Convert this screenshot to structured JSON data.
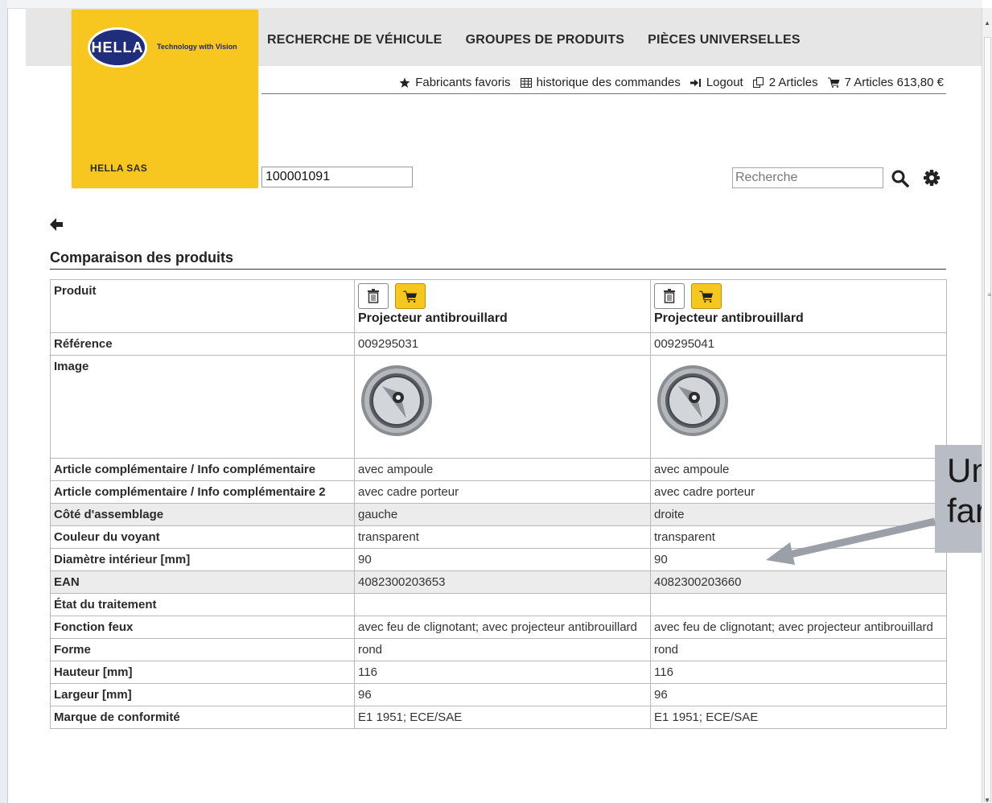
{
  "brand": {
    "logo_text": "HELLA",
    "tagline": "Technology with Vision",
    "company": "HELLA SAS",
    "color_yellow": "#f7c71f",
    "color_blue": "#1f2d7a"
  },
  "topnav": [
    {
      "label": "RECHERCHE DE VÉHICULE"
    },
    {
      "label": "GROUPES DE PRODUITS"
    },
    {
      "label": "PIÈCES UNIVERSELLES"
    }
  ],
  "usernav": {
    "favorites": "Fabricants favoris",
    "history": "historique des commandes",
    "logout": "Logout",
    "compare": "2 Articles",
    "cart": "7 Articles 613,80 €"
  },
  "reference_input": {
    "value": "100001091"
  },
  "search": {
    "placeholder": "Recherche"
  },
  "page": {
    "title": "Comparaison des produits"
  },
  "comparison": {
    "product_label": "Produit",
    "products": [
      {
        "name": "Projecteur antibrouillard"
      },
      {
        "name": "Projecteur antibrouillard"
      }
    ],
    "rows": [
      {
        "label": "Référence",
        "v1": "009295031",
        "v2": "009295041"
      },
      {
        "label": "Image",
        "v1": "",
        "v2": ""
      },
      {
        "label": "Article complémentaire / Info complémentaire",
        "v1": "avec ampoule",
        "v2": "avec ampoule"
      },
      {
        "label": "Article complémentaire / Info complémentaire 2",
        "v1": "avec cadre porteur",
        "v2": "avec cadre porteur"
      },
      {
        "label": "Côté d'assemblage",
        "v1": "gauche",
        "v2": "droite",
        "shade": true
      },
      {
        "label": "Couleur du voyant",
        "v1": "transparent",
        "v2": "transparent"
      },
      {
        "label": "Diamètre intérieur [mm]",
        "v1": "90",
        "v2": "90"
      },
      {
        "label": "EAN",
        "v1": "4082300203653",
        "v2": "4082300203660",
        "shade": true
      },
      {
        "label": "État du traitement",
        "v1": "",
        "v2": ""
      },
      {
        "label": "Fonction feux",
        "v1": "avec feu de clignotant; avec projecteur antibrouillard",
        "v2": "avec feu de clignotant; avec projecteur antibrouillard"
      },
      {
        "label": "Forme",
        "v1": "rond",
        "v2": "rond"
      },
      {
        "label": "Hauteur [mm]",
        "v1": "116",
        "v2": "116"
      },
      {
        "label": "Largeur [mm]",
        "v1": "96",
        "v2": "96"
      },
      {
        "label": "Marque de conformité",
        "v1": "E1 1951; ECE/SAE",
        "v2": "E1 1951; ECE/SAE"
      }
    ]
  },
  "annotation": {
    "text_line1": "Un",
    "text_line2": "far"
  }
}
